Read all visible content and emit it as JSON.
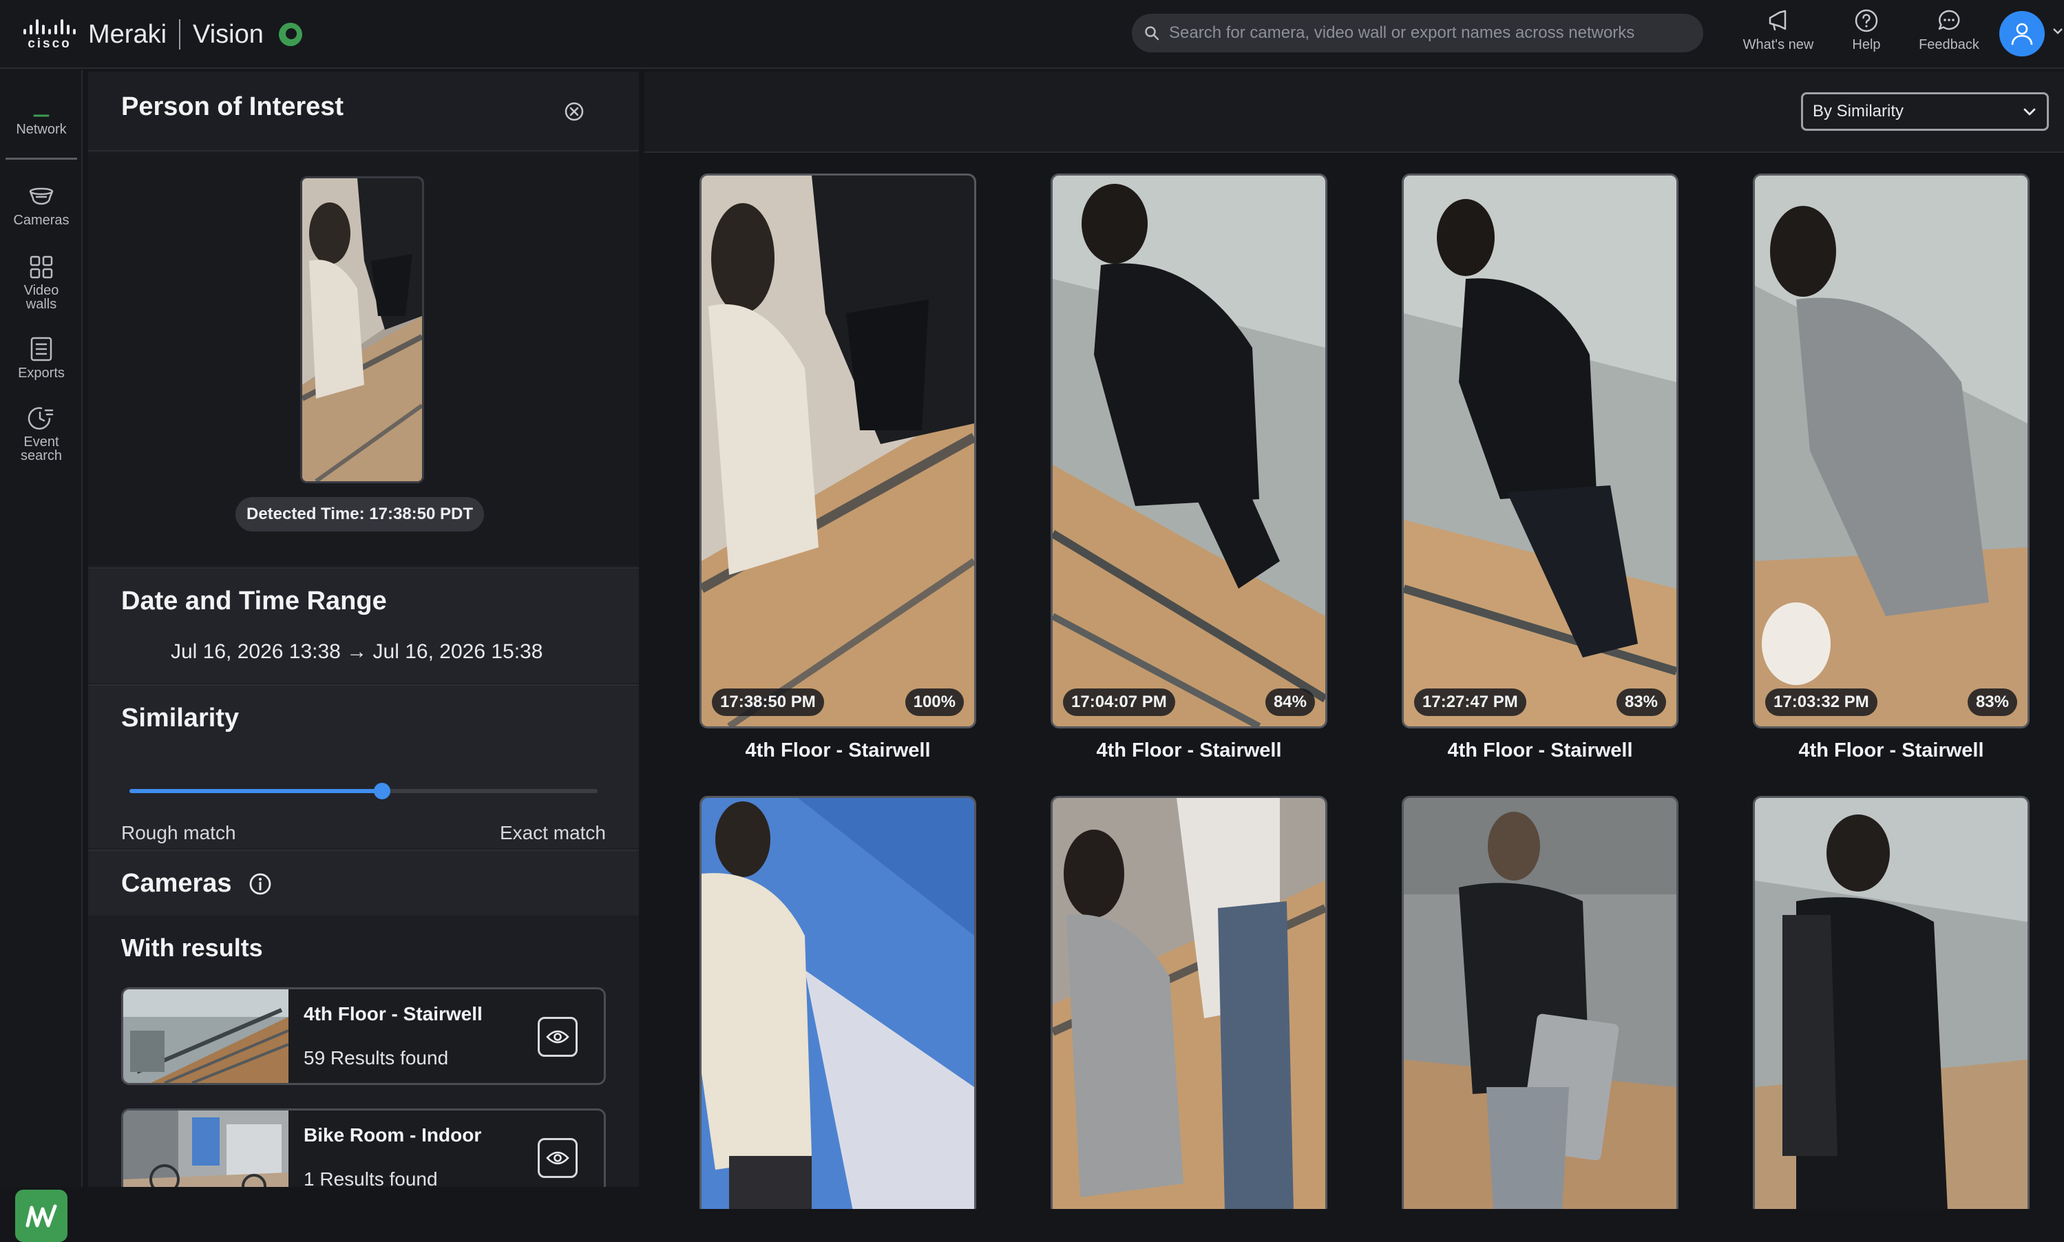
{
  "header": {
    "brand_meraki": "Meraki",
    "brand_vision": "Vision",
    "cisco_word": "cisco",
    "search_placeholder": "Search for camera, video wall or export names across networks",
    "whats_new": "What's new",
    "help": "Help",
    "feedback": "Feedback"
  },
  "nav": {
    "network": "Network",
    "cameras": "Cameras",
    "video_walls": "Video walls",
    "exports": "Exports",
    "event_search": "Event search"
  },
  "panel": {
    "title": "Person of Interest",
    "detected_time": "Detected Time: 17:38:50 PDT",
    "date_title": "Date and Time Range",
    "date_range": "Jul 16, 2026 13:38 → Jul 16, 2026 15:38",
    "similarity_title": "Similarity",
    "similarity_level": 0.54,
    "rough_match": "Rough match",
    "exact_match": "Exact match",
    "cameras_title": "Cameras",
    "with_results": "With results",
    "camera_results": [
      {
        "name": "4th Floor - Stairwell",
        "count": "59 Results found"
      },
      {
        "name": "Bike Room - Indoor",
        "count": "1 Results found"
      }
    ]
  },
  "main": {
    "sort": "By Similarity",
    "results": [
      {
        "time": "17:38:50 PM",
        "score": "100%",
        "camera": "4th Floor - Stairwell"
      },
      {
        "time": "17:04:07 PM",
        "score": "84%",
        "camera": "4th Floor - Stairwell"
      },
      {
        "time": "17:27:47 PM",
        "score": "83%",
        "camera": "4th Floor - Stairwell"
      },
      {
        "time": "17:03:32 PM",
        "score": "83%",
        "camera": "4th Floor - Stairwell"
      }
    ]
  },
  "colors": {
    "accent_blue": "#3f8ef0",
    "brand_green": "#3d9c52",
    "background": "#15161a"
  }
}
